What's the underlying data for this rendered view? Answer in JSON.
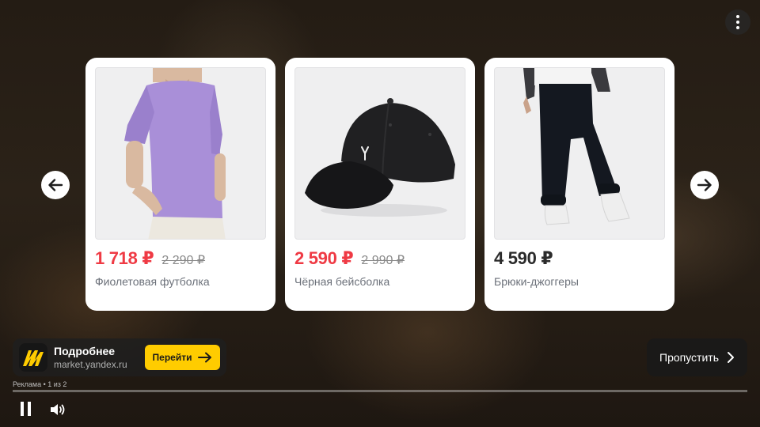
{
  "menu": {
    "icon": "more-vertical-icon"
  },
  "carousel": {
    "prev_icon": "arrow-left-icon",
    "next_icon": "arrow-right-icon",
    "products": [
      {
        "price": "1 718 ₽",
        "old_price": "2 290 ₽",
        "name": "Фиолетовая футболка",
        "price_color": "#ef3a44"
      },
      {
        "price": "2 590 ₽",
        "old_price": "2 990 ₽",
        "name": "Чёрная бейсболка",
        "price_color": "#ef3a44"
      },
      {
        "price": "4 590 ₽",
        "old_price": "",
        "name": "Брюки-джоггеры",
        "price_color": "#2b2b2b"
      }
    ]
  },
  "ad": {
    "title": "Подробнее",
    "url": "market.yandex.ru",
    "go_label": "Перейти",
    "brand_color": "#ffcc00",
    "label": "Реклама • 1 из 2"
  },
  "skip": {
    "label": "Пропустить"
  },
  "player": {
    "progress": 0,
    "pause_icon": "pause-icon",
    "volume_icon": "volume-icon"
  }
}
